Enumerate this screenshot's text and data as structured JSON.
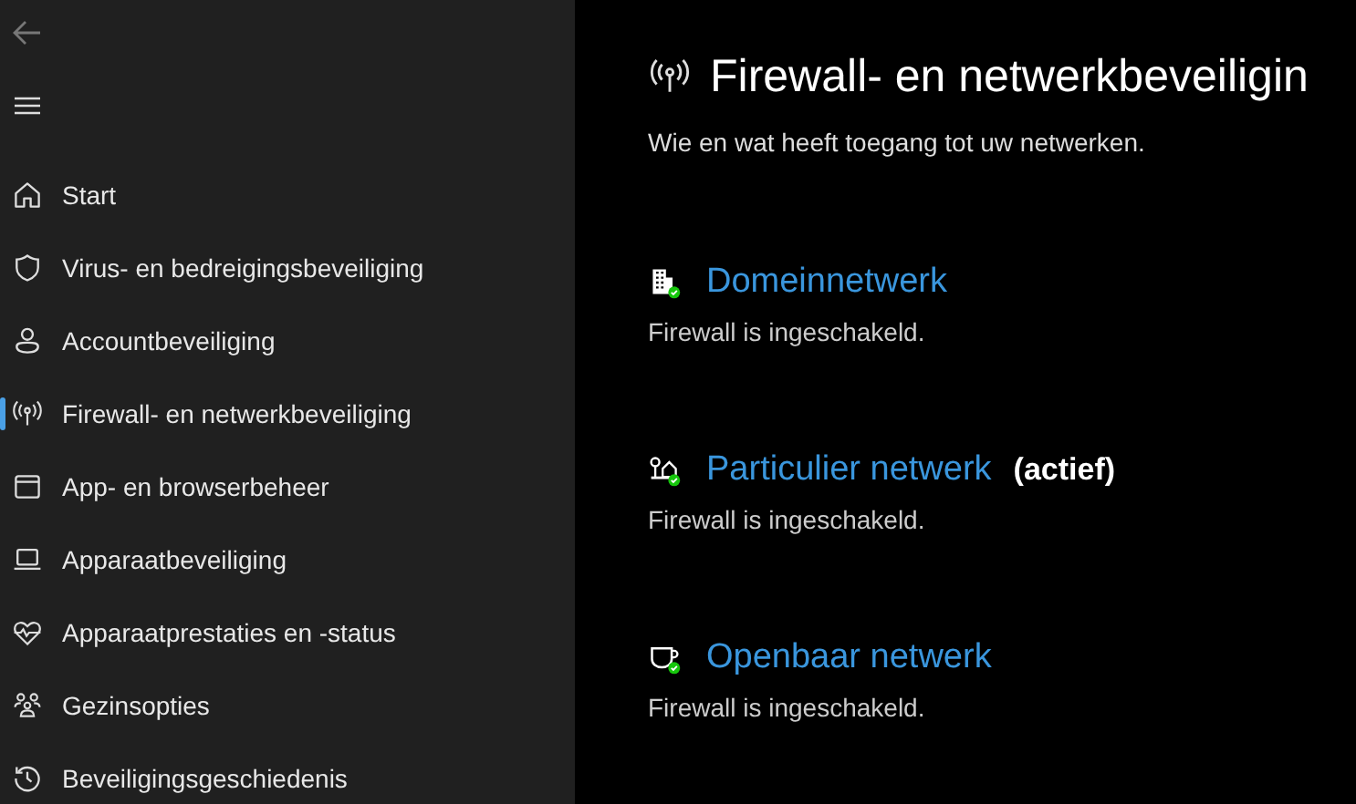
{
  "sidebar": {
    "items": [
      {
        "label": "Start",
        "selected": false
      },
      {
        "label": "Virus- en bedreigingsbeveiliging",
        "selected": false
      },
      {
        "label": "Accountbeveiliging",
        "selected": false
      },
      {
        "label": "Firewall- en netwerkbeveiliging",
        "selected": true
      },
      {
        "label": "App- en browserbeheer",
        "selected": false
      },
      {
        "label": "Apparaatbeveiliging",
        "selected": false
      },
      {
        "label": "Apparaatprestaties en -status",
        "selected": false
      },
      {
        "label": "Gezinsopties",
        "selected": false
      },
      {
        "label": "Beveiligingsgeschiedenis",
        "selected": false
      }
    ]
  },
  "page": {
    "title": "Firewall- en netwerkbeveiligin",
    "subtitle": "Wie en wat heeft toegang tot uw netwerken."
  },
  "networks": [
    {
      "name": "Domeinnetwerk",
      "kind": "domain",
      "status": "Firewall is ingeschakeld."
    },
    {
      "name": "Particulier netwerk",
      "kind": "private",
      "active_label": "(actief)",
      "status": "Firewall is ingeschakeld."
    },
    {
      "name": "Openbaar netwerk",
      "kind": "public",
      "status": "Firewall is ingeschakeld."
    }
  ]
}
